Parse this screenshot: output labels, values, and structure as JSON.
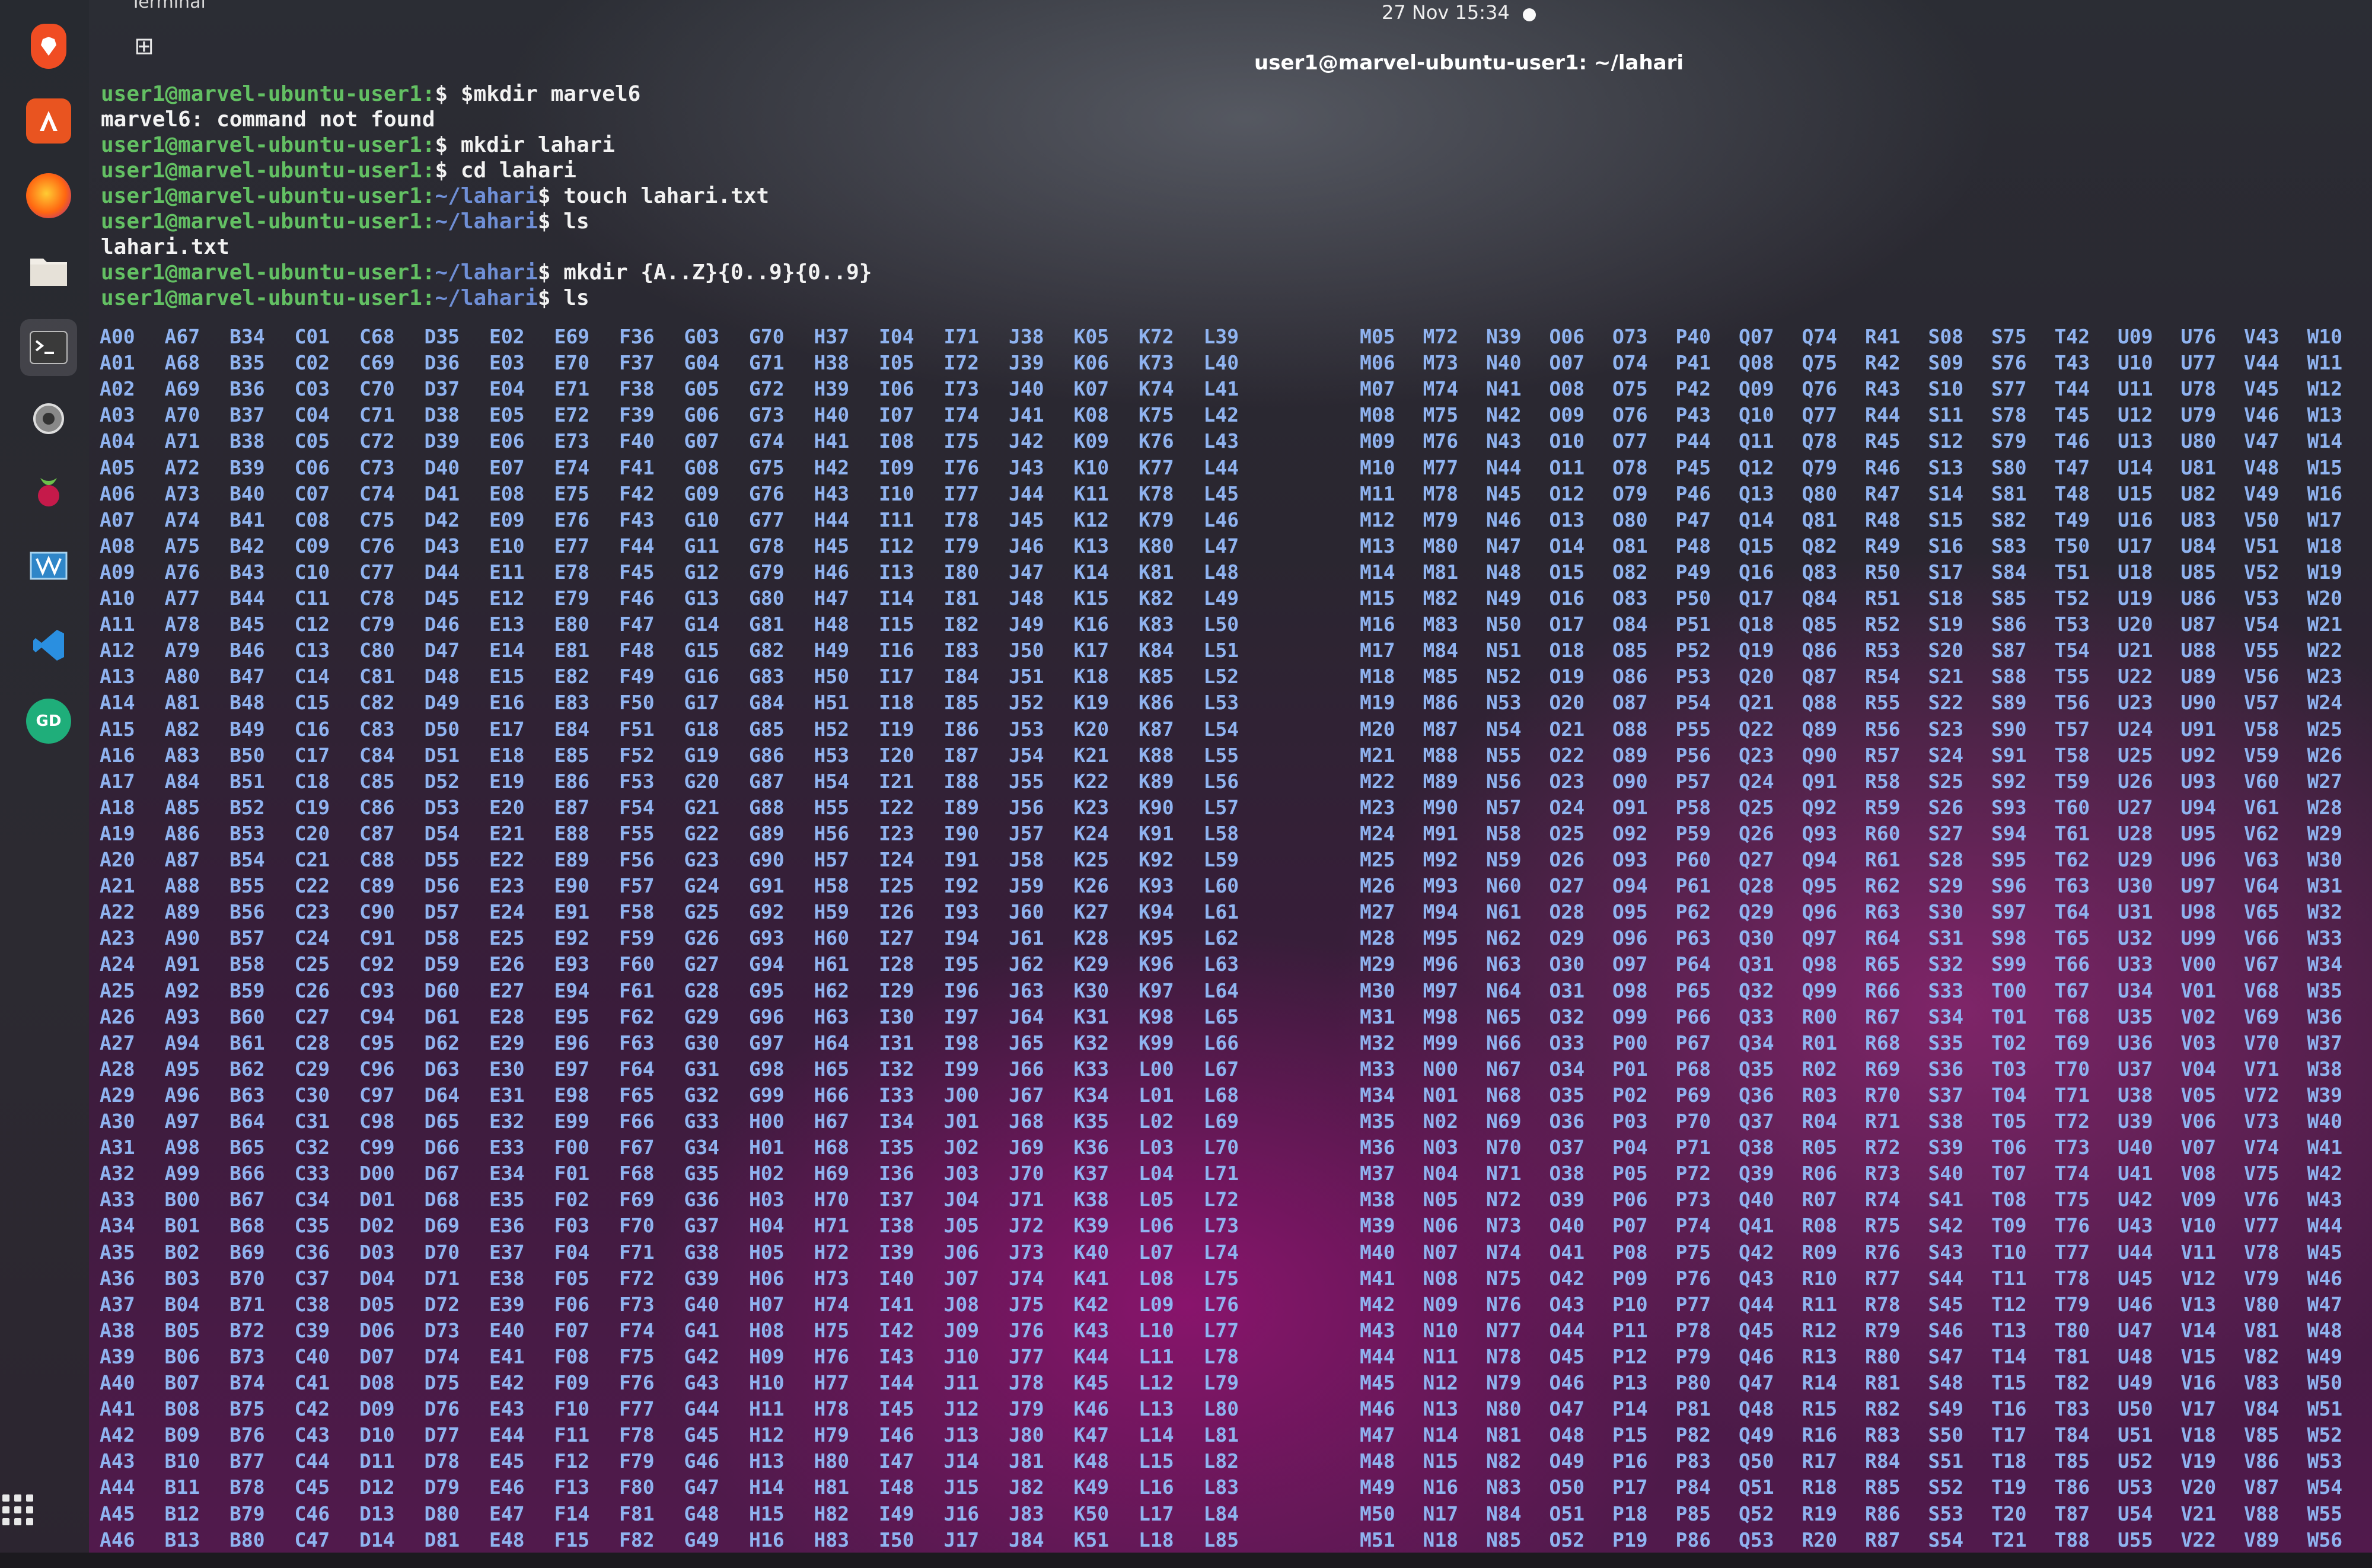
{
  "topbar": {
    "activities": "Terminal",
    "clock": "27 Nov  15:34"
  },
  "window": {
    "title": "user1@marvel-ubuntu-user1: ~/lahari",
    "new_tab_icon": "new-tab-icon"
  },
  "dock": {
    "apps": [
      "brave-icon",
      "app-center-icon",
      "firefox-icon",
      "files-icon",
      "terminal-icon",
      "settings-icon",
      "raspberry-pi-icon",
      "vnc-icon",
      "vscode-icon",
      "sync-icon"
    ],
    "show_apps_icon": "grid-icon"
  },
  "terminal": {
    "lines": [
      {
        "user": "user1@marvel-ubuntu-user1",
        "path": "",
        "cmd": "$ $mkdir marvel6"
      },
      {
        "plain": "marvel6: command not found"
      },
      {
        "user": "user1@marvel-ubuntu-user1",
        "path": "",
        "cmd": "$ mkdir lahari"
      },
      {
        "user": "user1@marvel-ubuntu-user1",
        "path": "",
        "cmd": "$ cd lahari"
      },
      {
        "user": "user1@marvel-ubuntu-user1",
        "path": "~/lahari",
        "cmd": "$ touch lahari.txt"
      },
      {
        "user": "user1@marvel-ubuntu-user1",
        "path": "~/lahari",
        "cmd": "$ ls"
      },
      {
        "plain": "lahari.txt"
      },
      {
        "user": "user1@marvel-ubuntu-user1",
        "path": "~/lahari",
        "cmd": "$ mkdir {A..Z}{0..9}{0..9}"
      },
      {
        "user": "user1@marvel-ubuntu-user1",
        "path": "~/lahari",
        "cmd": "$ ls"
      }
    ],
    "ls_columns_left": [
      {
        "letter": "A",
        "start": 0
      },
      {
        "letter": "A",
        "start": 67
      },
      {
        "letter": "B",
        "start": 34
      },
      {
        "letter": "C",
        "start": 1
      },
      {
        "letter": "C",
        "start": 68
      },
      {
        "letter": "D",
        "start": 35
      },
      {
        "letter": "E",
        "start": 2
      },
      {
        "letter": "E",
        "start": 69
      },
      {
        "letter": "F",
        "start": 36
      },
      {
        "letter": "G",
        "start": 3
      },
      {
        "letter": "G",
        "start": 70
      },
      {
        "letter": "H",
        "start": 37
      },
      {
        "letter": "I",
        "start": 4
      },
      {
        "letter": "I",
        "start": 71
      },
      {
        "letter": "J",
        "start": 38
      },
      {
        "letter": "K",
        "start": 5
      },
      {
        "letter": "K",
        "start": 72
      },
      {
        "letter": "L",
        "start": 39
      }
    ],
    "ls_columns_right": [
      {
        "letter": "M",
        "start": 5
      },
      {
        "letter": "M",
        "start": 72
      },
      {
        "letter": "N",
        "start": 39
      },
      {
        "letter": "O",
        "start": 6
      },
      {
        "letter": "O",
        "start": 73
      },
      {
        "letter": "P",
        "start": 40
      },
      {
        "letter": "Q",
        "start": 7
      },
      {
        "letter": "Q",
        "start": 74
      },
      {
        "letter": "R",
        "start": 41
      },
      {
        "letter": "S",
        "start": 8
      },
      {
        "letter": "S",
        "start": 75
      },
      {
        "letter": "T",
        "start": 42
      },
      {
        "letter": "U",
        "start": 9
      },
      {
        "letter": "U",
        "start": 76
      },
      {
        "letter": "V",
        "start": 43
      },
      {
        "letter": "W",
        "start": 10
      }
    ],
    "ls_rows": 47
  }
}
